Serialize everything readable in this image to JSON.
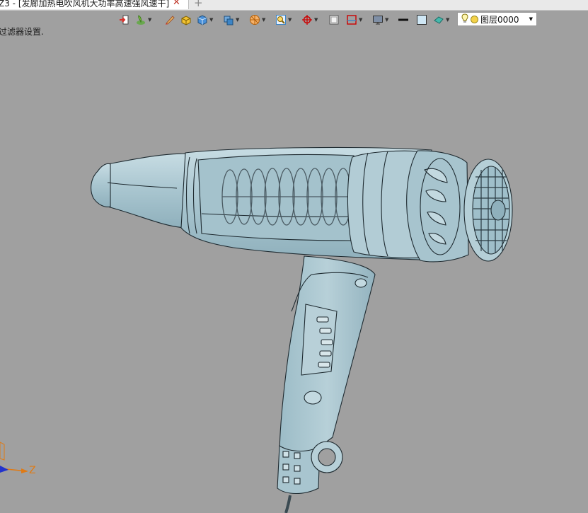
{
  "tab": {
    "title": "Z3 - [发廊加热电吹风机大功率高速强风速干]",
    "close_glyph": "✕",
    "add_glyph": "+"
  },
  "toolbar": {
    "items": [
      {
        "name": "exit-icon",
        "has_dropdown": false
      },
      {
        "name": "plant-icon",
        "has_dropdown": true
      },
      {
        "name": "pen-icon",
        "has_dropdown": false
      },
      {
        "name": "solid-box-icon",
        "has_dropdown": false
      },
      {
        "name": "cube-icon",
        "has_dropdown": true
      },
      {
        "name": "shaded-cube-icon",
        "has_dropdown": true
      },
      {
        "name": "render-sphere-icon",
        "has_dropdown": true
      },
      {
        "name": "zoom-view-icon",
        "has_dropdown": true
      },
      {
        "name": "rotate-target-icon",
        "has_dropdown": true
      },
      {
        "name": "frame-icon",
        "has_dropdown": false
      },
      {
        "name": "section-icon",
        "has_dropdown": true
      },
      {
        "name": "display-icon",
        "has_dropdown": true
      },
      {
        "name": "line-weight-icon",
        "has_dropdown": false
      },
      {
        "name": "color-swatch-icon",
        "has_dropdown": false
      },
      {
        "name": "paint-icon",
        "has_dropdown": true
      }
    ],
    "layer_value": "图层0000"
  },
  "prompt": "过滤器设置.",
  "axis": {
    "z_label": "Z"
  },
  "colors": {
    "viewport_bg": "#a0a0a0",
    "model_fill": "#a9c6d0",
    "model_edge": "#1e2a30",
    "axis_z": "#e07a14"
  }
}
